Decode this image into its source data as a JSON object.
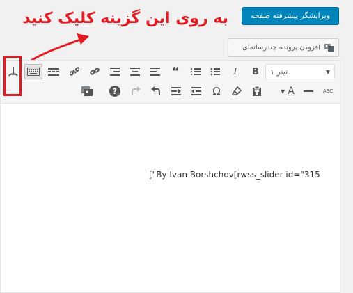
{
  "header": {
    "builder_button_label": "ویرایشگر پیشرفته صفحه",
    "annotation_text": "به روی این گزینه کلیک کنید",
    "add_media_label": "افزودن پرونده چندرسانه‌ای"
  },
  "toolbar": {
    "format_select_value": "تیتر ۱",
    "row1": [
      "format-select",
      "bold-icon",
      "italic-icon",
      "bulleted-list-icon",
      "numbered-list-icon",
      "blockquote-icon",
      "align-left-icon",
      "align-center-icon",
      "align-right-icon",
      "link-icon",
      "unlink-icon",
      "read-more-icon",
      "toolbar-toggle-icon",
      "shortcode-icon"
    ],
    "row2": [
      "strikethrough-icon",
      "horizontal-line-icon",
      "text-color-icon",
      "paste-as-text-icon",
      "clear-formatting-icon",
      "special-character-icon",
      "outdent-icon",
      "indent-icon",
      "undo-icon",
      "redo-icon",
      "help-icon",
      "image-gallery-icon"
    ],
    "bold_glyph": "B",
    "italic_glyph": "I",
    "blockquote_glyph": "“",
    "text_color_glyph": "A",
    "special_char_glyph": "Ω",
    "help_glyph": "?",
    "strikethrough_glyph": "ABC"
  },
  "editor": {
    "content": "[\"By Ivan Borshchov[rwss_slider id=\"315"
  },
  "colors": {
    "accent": "#0085ba",
    "annotation": "#e31b23"
  }
}
